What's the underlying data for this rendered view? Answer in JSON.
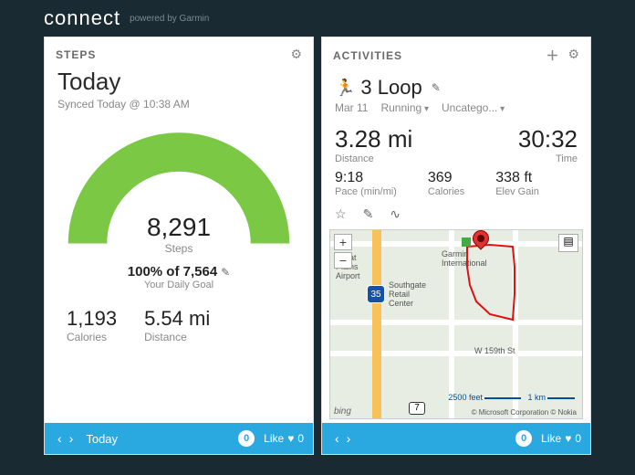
{
  "brand": {
    "logo": "connect",
    "powered": "powered by Garmin"
  },
  "steps_panel": {
    "title": "STEPS",
    "main_title": "Today",
    "synced": "Synced Today @ 10:38 AM",
    "steps_value": "8,291",
    "steps_label": "Steps",
    "goal_line": "100% of 7,564",
    "goal_sub": "Your Daily Goal",
    "calories_value": "1,193",
    "calories_label": "Calories",
    "distance_value": "5.54 mi",
    "distance_label": "Distance",
    "footer_label": "Today",
    "comments": "0",
    "like_label": "Like",
    "likes": "0"
  },
  "activities_panel": {
    "title": "ACTIVITIES",
    "activity_name": "3 Loop",
    "date": "Mar 11",
    "type": "Running",
    "category": "Uncatego...",
    "distance": "3.28 mi",
    "distance_label": "Distance",
    "time": "30:32",
    "time_label": "Time",
    "pace": "9:18",
    "pace_label": "Pace (min/mi)",
    "calories": "369",
    "calories_label": "Calories",
    "elev": "338 ft",
    "elev_label": "Elev Gain",
    "comments": "0",
    "like_label": "Like",
    "likes": "0"
  },
  "map": {
    "poi1": "Great\nPlains\nAirport",
    "poi2": "Garmin\nInternational",
    "poi3": "Southgate\nRetail\nCenter",
    "hwy": "35",
    "route": "7",
    "scale_ft": "2500 feet",
    "scale_km": "1 km",
    "street": "W 159th St",
    "attrib": "© Microsoft Corporation   © Nokia",
    "bing": "bing"
  }
}
